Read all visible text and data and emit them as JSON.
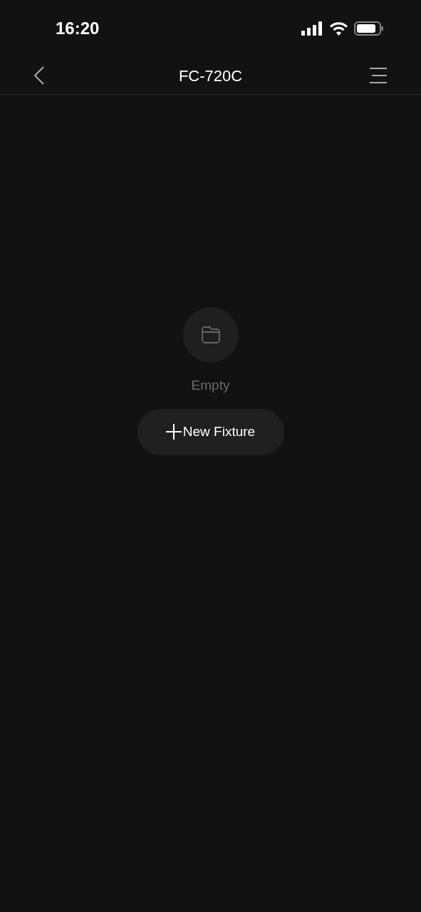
{
  "status_bar": {
    "time": "16:20"
  },
  "nav": {
    "title": "FC-720C"
  },
  "empty_state": {
    "message": "Empty",
    "button": "New Fixture"
  }
}
